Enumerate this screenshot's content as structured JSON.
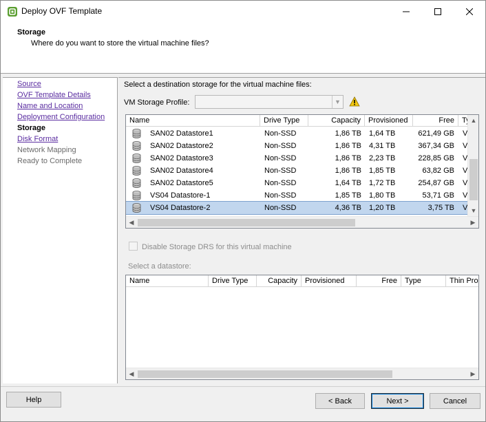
{
  "window": {
    "title": "Deploy OVF Template"
  },
  "header": {
    "title": "Storage",
    "subtitle": "Where do you want to store the virtual machine files?"
  },
  "nav": {
    "items": [
      {
        "label": "Source",
        "state": "link"
      },
      {
        "label": "OVF Template Details",
        "state": "link"
      },
      {
        "label": "Name and Location",
        "state": "link"
      },
      {
        "label": "Deployment Configuration",
        "state": "link"
      },
      {
        "label": "Storage",
        "state": "current"
      },
      {
        "label": "Disk Format",
        "state": "link"
      },
      {
        "label": "Network Mapping",
        "state": "future"
      },
      {
        "label": "Ready to Complete",
        "state": "future"
      }
    ]
  },
  "main": {
    "prompt": "Select a destination storage for the virtual machine files:",
    "profile_label": "VM Storage Profile:",
    "profile_value": "",
    "datastores": {
      "columns": [
        "Name",
        "Drive Type",
        "Capacity",
        "Provisioned",
        "Free",
        "Ty"
      ],
      "rows": [
        {
          "name": "SAN02 Datastore1",
          "drive_type": "Non-SSD",
          "capacity": "1,86 TB",
          "provisioned": "1,64 TB",
          "free": "621,49 GB",
          "type": "VI",
          "selected": false
        },
        {
          "name": "SAN02 Datastore2",
          "drive_type": "Non-SSD",
          "capacity": "1,86 TB",
          "provisioned": "4,31 TB",
          "free": "367,34 GB",
          "type": "VI",
          "selected": false
        },
        {
          "name": "SAN02 Datastore3",
          "drive_type": "Non-SSD",
          "capacity": "1,86 TB",
          "provisioned": "2,23 TB",
          "free": "228,85 GB",
          "type": "VI",
          "selected": false
        },
        {
          "name": "SAN02 Datastore4",
          "drive_type": "Non-SSD",
          "capacity": "1,86 TB",
          "provisioned": "1,85 TB",
          "free": "63,82 GB",
          "type": "VI",
          "selected": false
        },
        {
          "name": "SAN02 Datastore5",
          "drive_type": "Non-SSD",
          "capacity": "1,64 TB",
          "provisioned": "1,72 TB",
          "free": "254,87 GB",
          "type": "VI",
          "selected": false
        },
        {
          "name": "VS04 Datastore-1",
          "drive_type": "Non-SSD",
          "capacity": "1,85 TB",
          "provisioned": "1,80 TB",
          "free": "53,71 GB",
          "type": "VI",
          "selected": false
        },
        {
          "name": "VS04 Datastore-2",
          "drive_type": "Non-SSD",
          "capacity": "4,36 TB",
          "provisioned": "1,20 TB",
          "free": "3,75 TB",
          "type": "VI",
          "selected": true
        }
      ]
    },
    "disable_drs_label": "Disable Storage DRS for this virtual machine",
    "disable_drs_checked": false,
    "select_datastore_label": "Select a datastore:",
    "datastore_detail": {
      "columns": [
        "Name",
        "Drive Type",
        "Capacity",
        "Provisioned",
        "Free",
        "Type",
        "Thin Pro"
      ]
    }
  },
  "footer": {
    "help_label": "Help",
    "back_label": "< Back",
    "next_label": "Next >",
    "cancel_label": "Cancel"
  },
  "colors": {
    "selection_bg": "#c1d6ee",
    "link": "#5a2ca0",
    "disabled_text": "#8c8c8c",
    "warning": "#f2c811"
  }
}
